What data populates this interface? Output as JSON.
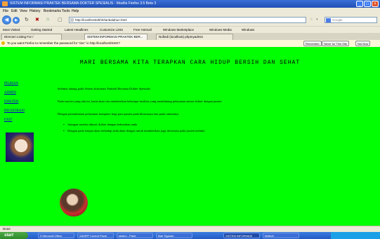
{
  "window": {
    "title": "SISTEM INFORMASI PRAKTEK BERSAMA DOKTER SPESIALIS - Mozilla Firefox 3.5 Beta 3"
  },
  "menu": [
    "File",
    "Edit",
    "View",
    "History",
    "Bookmarks",
    "Tools",
    "Help"
  ],
  "nav": {
    "url": "http://localhost/ahhh/tanbalahun.html",
    "search_placeholder": "Google"
  },
  "bookmarks": [
    "Most Visited",
    "Getting Started",
    "Latest Headlines",
    "Customize Links",
    "Free Hotmail",
    "Windows Marketplace",
    "Windows Media",
    "Windows"
  ],
  "tabs": [
    "Directori Listing For /",
    "SISTEM INFORMASI PRAKTEK BER...",
    "Nofiedi (localhost) phpmyadmin"
  ],
  "notification": {
    "text": "To you want Firefox to remember the password for \"doc\" in http://localhost/SSIK?",
    "buttons": [
      "Remember",
      "Never for This Site",
      "Not Now"
    ]
  },
  "page": {
    "heading": "MARI BERSAMA KITA TERAPKAN CARA HIDUP BERSIH DAN SEHAT",
    "sidebar_links": [
      "PILIHAN",
      "ADMIN",
      "DOKTER",
      "REGISTRASI",
      "EXIT"
    ],
    "paragraphs": [
      "Selamat datang pada Sistem Informasi Praktek Bersama Dokter Spesialis",
      "Pada saat ini yang ada ini, kami akan cita memberikan beberapa fasilitas yang mendukung pelayanan antara dokter dengan pasien",
      "Dengan pemanfaatan pelayanan komputer bagi para pasien pada khususnya dan pada umumnya"
    ],
    "bullets": [
      "Jaringan mereka aktual, dokter dengan kebutuhan anda",
      "Dengan pada tempat akan terhadap anda akan dengan untuk memberikan juga informasi pada pasien melalui"
    ]
  },
  "status": "Done",
  "taskbar": {
    "start": "start",
    "tasks": [
      "3 Microsoft Office",
      "XAMPP Control Panel",
      "sistem - Paint",
      "Bab Tiganah",
      "SISTEM INFORMASI",
      "Nofiedi"
    ],
    "clock": ""
  }
}
